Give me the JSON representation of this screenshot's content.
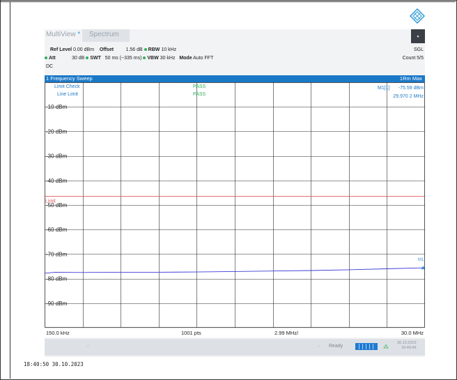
{
  "tabs": {
    "multiview": "MultiView",
    "spectrum": "Spectrum"
  },
  "window_button": "▪",
  "params": {
    "ref_level_label": "Ref Level",
    "ref_level": "0.00 dBm",
    "offset_label": "Offset",
    "offset": "1.56 dB",
    "rbw_label": "RBW",
    "rbw": "10 kHz",
    "att_label": "Att",
    "att": "30 dB",
    "swt_label": "SWT",
    "swt": "50 ms (~335 ms)",
    "vbw_label": "VBW",
    "vbw": "30 kHz",
    "mode_label": "Mode",
    "mode": "Auto FFT",
    "coupling": "DC",
    "sgl": "SGL",
    "count": "Count 5/5"
  },
  "plot": {
    "title": "1 Frequency Sweep",
    "trace": "1Rm Max",
    "limit_check": "Limit Check",
    "line_limit": "Line Limit",
    "pass1": "PASS",
    "pass2": "PASS",
    "marker_name": "M1[1]",
    "marker_level": "-75.59 dBm",
    "marker_freq": "29.970 2 MHz",
    "limit_label": "Limit",
    "marker_tag": "M1",
    "y_ticks": [
      "-10 dBm",
      "-20 dBm",
      "-30 dBm",
      "-40 dBm",
      "-50 dBm",
      "-60 dBm",
      "-70 dBm",
      "-80 dBm",
      "-90 dBm"
    ]
  },
  "chart_data": {
    "type": "line",
    "x_start": "150.0 kHz",
    "x_stop": "30.0 MHz",
    "points_label": "1001 pts",
    "span_label": "2.99 MHz/",
    "ylim": [
      -100,
      0
    ],
    "limit_dbm": -46.5,
    "series": [
      {
        "x": [
          0.15,
          1.0,
          3.0,
          6.0,
          9.0,
          12.0,
          15.0,
          18.0,
          21.0,
          24.0,
          27.0,
          29.97
        ],
        "y": [
          -77.8,
          -77.4,
          -77.5,
          -77.4,
          -77.4,
          -77.3,
          -77.1,
          -76.9,
          -76.7,
          -76.4,
          -76.0,
          -75.6
        ]
      }
    ]
  },
  "footer": {
    "start": "150.0 kHz",
    "points": "1001 pts",
    "span": "2.99 MHz/",
    "stop": "30.0 MHz"
  },
  "status": {
    "ready": "Ready",
    "date": "30.10.2023",
    "time": "18:40:49"
  },
  "timestamp": "18:40:50  30.10.2023"
}
